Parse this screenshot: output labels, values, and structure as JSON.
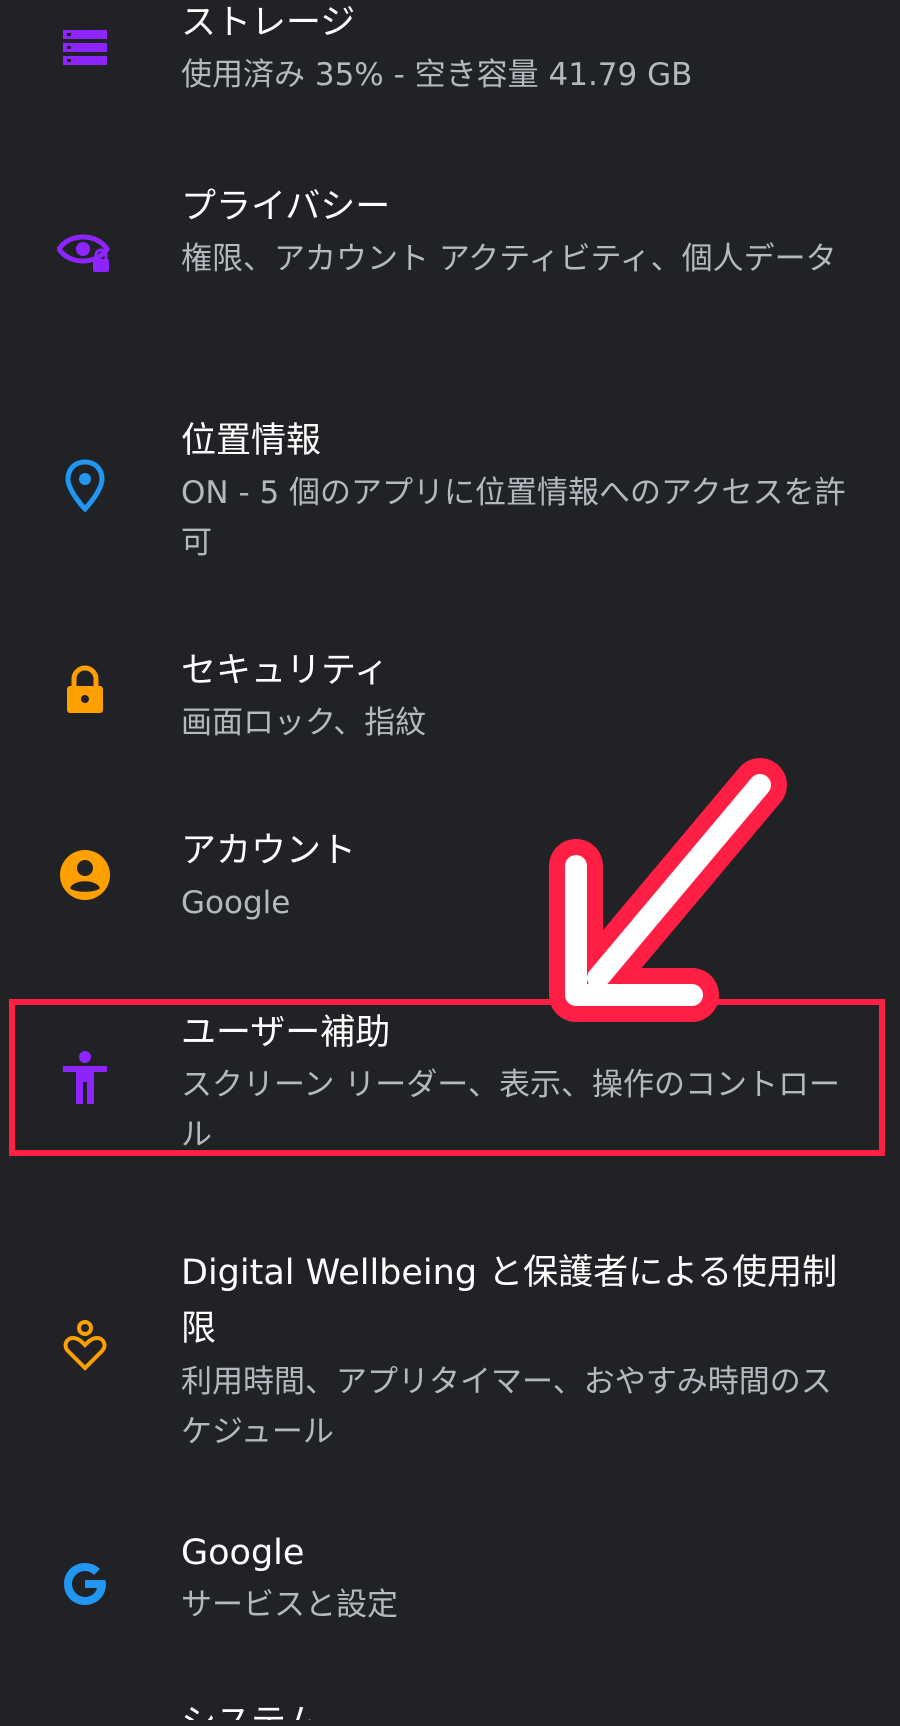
{
  "settings": {
    "items": [
      {
        "title": "ストレージ",
        "summary": "使用済み 35% - 空き容量 41.79 GB",
        "icon": "storage-icon",
        "color": "#8e24ff"
      },
      {
        "title": "プライバシー",
        "summary": "権限、アカウント アクティビティ、個人データ",
        "icon": "privacy-eye-icon",
        "color": "#8e24ff"
      },
      {
        "title": "位置情報",
        "summary": "ON - 5 個のアプリに位置情報へのアクセスを許可",
        "icon": "location-pin-icon",
        "color": "#2196f3"
      },
      {
        "title": "セキュリティ",
        "summary": "画面ロック、指紋",
        "icon": "lock-icon",
        "color": "#ffa000"
      },
      {
        "title": "アカウント",
        "summary": "Google",
        "icon": "account-circle-icon",
        "color": "#ffa000"
      },
      {
        "title": "ユーザー補助",
        "summary": "スクリーン リーダー、表示、操作のコントロール",
        "icon": "accessibility-icon",
        "color": "#8e24ff"
      },
      {
        "title": "Digital Wellbeing と保護者による使用制限",
        "summary": "利用時間、アプリタイマー、おやすみ時間のスケジュール",
        "icon": "wellbeing-heart-icon",
        "color": "#ffa000"
      },
      {
        "title": "Google",
        "summary": "サービスと設定",
        "icon": "google-g-icon",
        "color": "#2196f3"
      }
    ],
    "partial_title": "システム"
  },
  "annotation": {
    "highlight_color": "#ff1e44"
  }
}
